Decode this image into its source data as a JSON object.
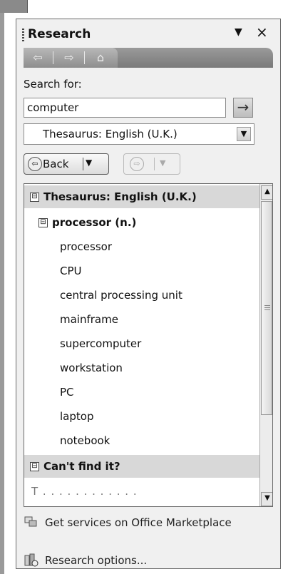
{
  "pane": {
    "title": "Research",
    "menu_arrow": "▼",
    "close": "×"
  },
  "nav": {
    "back_icon": "⇦",
    "forward_icon": "⇨",
    "home_icon": "⌂"
  },
  "search": {
    "label": "Search for:",
    "value": "computer",
    "go_icon": "→"
  },
  "source": {
    "selected": "Thesaurus: English (U.K.)",
    "dropdown_icon": "▼"
  },
  "history": {
    "back_label": "Back",
    "back_dropdown": "▼",
    "forward_dropdown": "▼"
  },
  "results": {
    "section_title": "Thesaurus: English (U.K.)",
    "group_title": "processor (n.)",
    "words": [
      "processor",
      "CPU",
      "central processing unit",
      "mainframe",
      "supercomputer",
      "workstation",
      "PC",
      "laptop",
      "notebook"
    ],
    "help_title": "Can't find it?",
    "cut_off_text": "T  . . . . . . . . . . . .",
    "expand_glyph": "⊟"
  },
  "footer": {
    "marketplace_link": "Get services on Office Marketplace",
    "options_link": "Research options..."
  },
  "colors": {
    "panel_bg": "#f0f0f0",
    "section_head_bg": "#d8d8d8",
    "nav_bar_bg": "#8a8a8a"
  }
}
